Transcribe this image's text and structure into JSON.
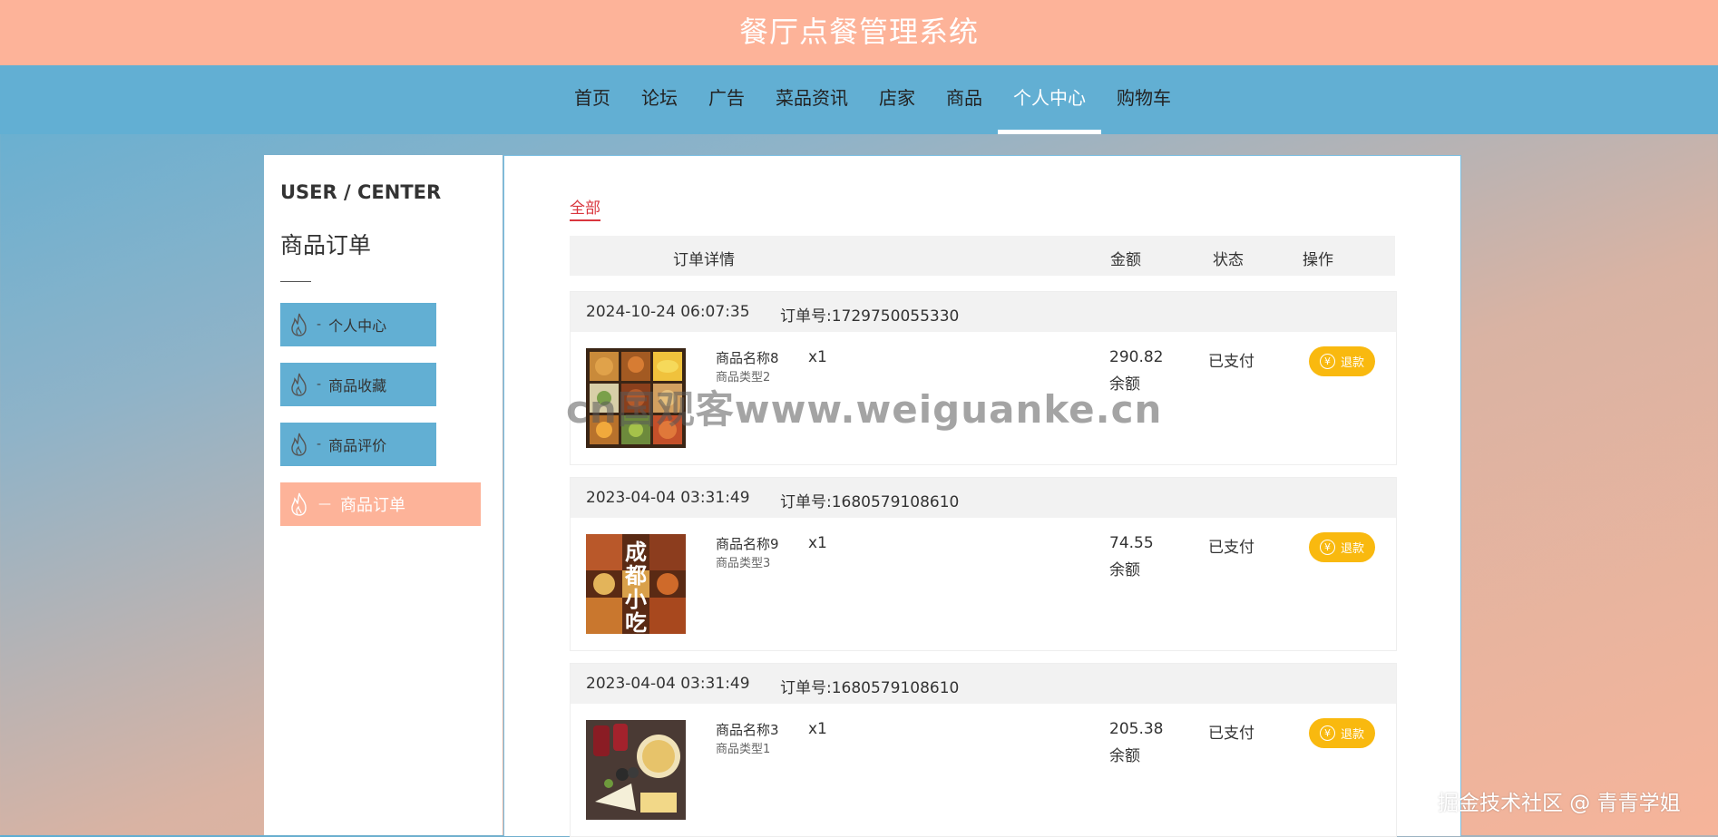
{
  "header": {
    "title": "餐厅点餐管理系统"
  },
  "nav": {
    "items": [
      {
        "label": "首页"
      },
      {
        "label": "论坛"
      },
      {
        "label": "广告"
      },
      {
        "label": "菜品资讯"
      },
      {
        "label": "店家"
      },
      {
        "label": "商品"
      },
      {
        "label": "个人中心"
      },
      {
        "label": "购物车"
      }
    ],
    "active": "个人中心"
  },
  "sidebar": {
    "heading": "USER / CENTER",
    "subtitle": "商品订单",
    "items": [
      {
        "label": "个人中心",
        "dash": "-"
      },
      {
        "label": "商品收藏",
        "dash": "-"
      },
      {
        "label": "商品评价",
        "dash": "-"
      },
      {
        "label": "商品订单",
        "dash": "—"
      }
    ],
    "active": "商品订单"
  },
  "main": {
    "tab_all": "全部",
    "columns": {
      "details": "订单详情",
      "amount": "金额",
      "status": "状态",
      "actions": "操作"
    },
    "orders": [
      {
        "datetime": "2024-10-24 06:07:35",
        "order_no": "订单号:1729750055330",
        "product_name": "商品名称8",
        "product_type": "商品类型2",
        "quantity": "x1",
        "amount": "290.82",
        "pay_type": "余额",
        "status": "已支付",
        "refund_label": "退款",
        "image_icon": "food-platter-image"
      },
      {
        "datetime": "2023-04-04 03:31:49",
        "order_no": "订单号:1680579108610",
        "product_name": "商品名称9",
        "product_type": "商品类型3",
        "quantity": "x1",
        "amount": "74.55",
        "pay_type": "余额",
        "status": "已支付",
        "refund_label": "退款",
        "image_icon": "chengdu-snacks-image",
        "image_text": "成都小吃"
      },
      {
        "datetime": "2023-04-04 03:31:49",
        "order_no": "订单号:1680579108610",
        "product_name": "商品名称3",
        "product_type": "商品类型1",
        "quantity": "x1",
        "amount": "205.38",
        "pay_type": "余额",
        "status": "已支付",
        "refund_label": "退款",
        "image_icon": "wine-cheese-image"
      }
    ]
  },
  "overlay": {
    "watermark": "cn国观客www.weiguanke.cn",
    "credit": "掘金技术社区 @ 青青学姐"
  },
  "colors": {
    "header_bg": "#fdb399",
    "nav_bg": "#62afd3",
    "sidebar_btn": "#62afd3",
    "sidebar_btn_active": "#fdb399",
    "refund_btn": "#f9b90f",
    "tab_active": "#d9363e"
  }
}
